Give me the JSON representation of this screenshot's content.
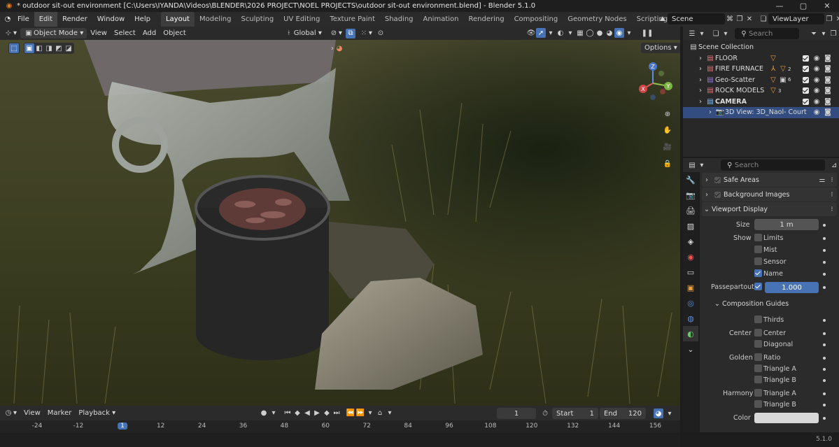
{
  "title": "* outdoor sit-out environment [C:\\Users\\IYANDA\\Videos\\BLENDER\\2026 PROJECT\\NOEL PROJECTS\\outdoor sit-out environment.blend] - Blender 5.1.0",
  "menus": [
    "File",
    "Edit",
    "Render",
    "Window",
    "Help"
  ],
  "workspaces": [
    "Layout",
    "Modeling",
    "Sculpting",
    "UV Editing",
    "Texture Paint",
    "Shading",
    "Animation",
    "Rendering",
    "Compositing",
    "Geometry Nodes",
    "Scripting"
  ],
  "scene": "Scene",
  "view_layer": "ViewLayer",
  "viewport_header": {
    "mode": "Object Mode",
    "view": "View",
    "select": "Select",
    "add": "Add",
    "object": "Object",
    "orientation": "Global",
    "options": "Options"
  },
  "timeline": {
    "view": "View",
    "marker": "Marker",
    "playback": "Playback",
    "current_frame": "1",
    "start_label": "Start",
    "start": "1",
    "end_label": "End",
    "end": "120",
    "ruler": [
      "-24",
      "-12",
      "1",
      "12",
      "24",
      "36",
      "48",
      "60",
      "72",
      "84",
      "96",
      "108",
      "120",
      "132",
      "144",
      "156"
    ]
  },
  "outliner": {
    "search_placeholder": "Search",
    "root": "Scene Collection",
    "items": [
      {
        "label": "FLOOR",
        "badge": ""
      },
      {
        "label": "FIRE FURNACE",
        "badge": "2"
      },
      {
        "label": "Geo-Scatter",
        "badge": "6"
      },
      {
        "label": "ROCK MODELS",
        "badge": "3"
      },
      {
        "label": "CAMERA",
        "badge": ""
      }
    ],
    "selected": "3D View: 3D_Naol- Court"
  },
  "properties": {
    "search_placeholder": "Search",
    "safe_areas": "Safe Areas",
    "background_images": "Background Images",
    "viewport_display": "Viewport Display",
    "size_label": "Size",
    "size_value": "1 m",
    "show_label": "Show",
    "limits": "Limits",
    "mist": "Mist",
    "sensor": "Sensor",
    "name": "Name",
    "passepartout_label": "Passepartout",
    "passepartout_value": "1.000",
    "composition_guides": "Composition Guides",
    "thirds": "Thirds",
    "center_label": "Center",
    "center": "Center",
    "diagonal": "Diagonal",
    "golden_label": "Golden",
    "ratio": "Ratio",
    "triangle_a": "Triangle A",
    "triangle_b": "Triangle B",
    "harmony_label": "Harmony",
    "h_triangle_a": "Triangle A",
    "h_triangle_b": "Triangle B",
    "color_label": "Color"
  },
  "version": "5.1.0",
  "gizmo": {
    "x": "X",
    "y": "Y",
    "z": "Z"
  },
  "colors": {
    "accent": "#4772b3",
    "header": "#2b2b2b",
    "panel": "#282828"
  }
}
